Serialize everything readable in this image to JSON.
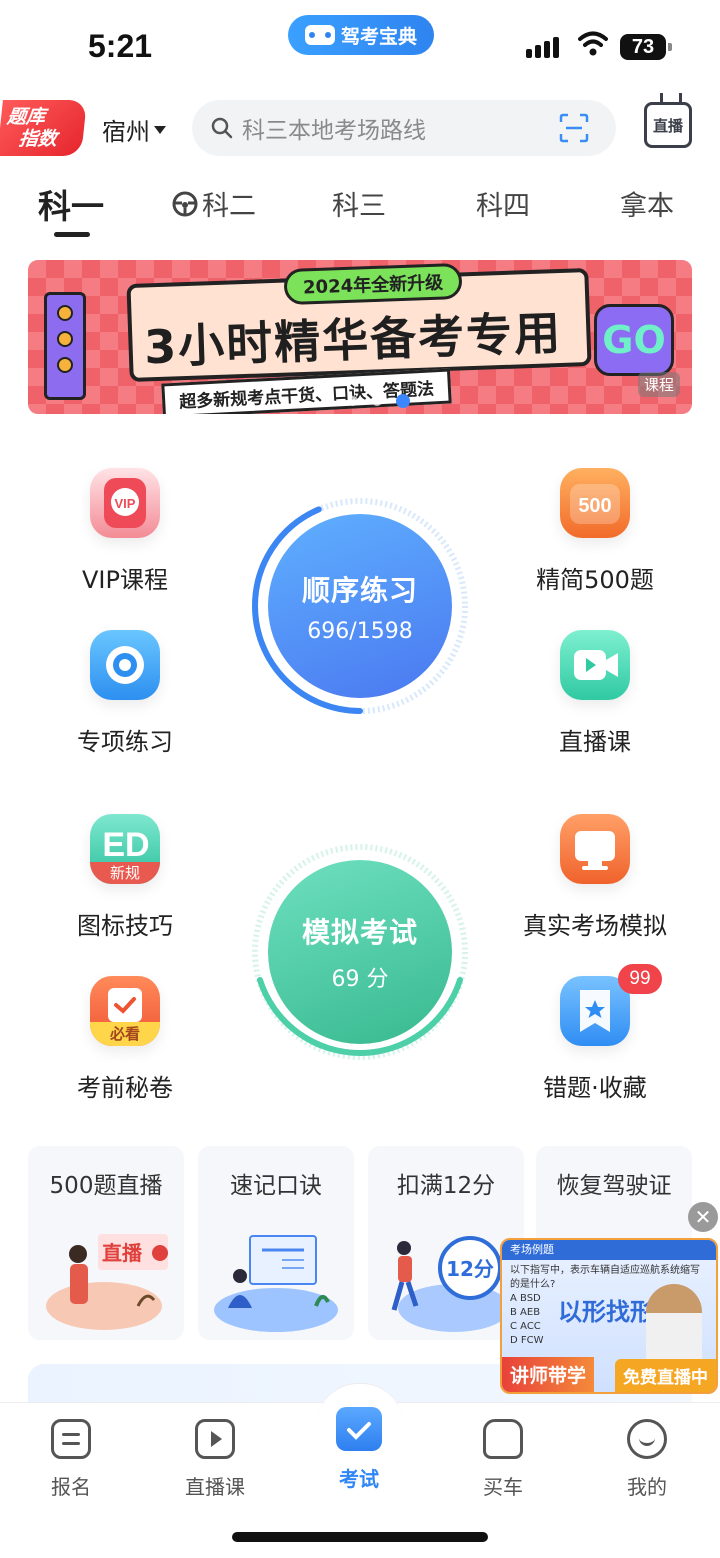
{
  "status_bar": {
    "time": "5:21",
    "app_pill": "驾考宝典",
    "battery": "73"
  },
  "header": {
    "tiku_badge_line1": "题库",
    "tiku_badge_line2": "指数",
    "city": "宿州",
    "search_placeholder": "科三本地考场路线",
    "live_label": "直播"
  },
  "tabs": [
    {
      "label": "科一"
    },
    {
      "label": "科二"
    },
    {
      "label": "科三"
    },
    {
      "label": "科四"
    },
    {
      "label": "拿本"
    }
  ],
  "banner": {
    "tag": "2024年全新升级",
    "title": "3小时精华备考专用",
    "subtitle": "超多新规考点干货、口诀、答题法",
    "go": "GO",
    "course_tag": "课程"
  },
  "features": {
    "vip": "VIP课程",
    "jingjian": "精简500题",
    "zhuanxiang": "专项练习",
    "zhibo": "直播课",
    "tubiao": "图标技巧",
    "tubiao_badge": "新规",
    "zhenshi": "真实考场模拟",
    "kaoqian": "考前秘卷",
    "kaoqian_badge": "必看",
    "cuoti": "错题·收藏",
    "cuoti_count": "99",
    "icon_500": "500",
    "icon_vip": "VIP"
  },
  "practice": {
    "title": "顺序练习",
    "progress_text": "696/1598",
    "progress_fraction": 0.4356
  },
  "exam": {
    "title": "模拟考试",
    "score_text": "69 分"
  },
  "quick_cards": [
    {
      "title": "500题直播",
      "art_text": "直播"
    },
    {
      "title": "速记口诀"
    },
    {
      "title": "扣满12分",
      "art_text": "12分"
    },
    {
      "title": "恢复驾驶证"
    }
  ],
  "float_video": {
    "header": "考场例题",
    "question": "以下指写中，表示车辆自适应巡航系统缩写的是什么?",
    "options": [
      "A  BSD",
      "B  AEB",
      "C  ACC",
      "D  FCW"
    ],
    "big_text": "以形找形",
    "left_label": "讲师带学",
    "right_label": "免费直播中"
  },
  "bottom_nav": [
    {
      "label": "报名"
    },
    {
      "label": "直播课"
    },
    {
      "label": "考试"
    },
    {
      "label": "买车"
    },
    {
      "label": "我的"
    }
  ],
  "colors": {
    "accent": "#2f86f6",
    "practice_blue": "#4a8df5",
    "exam_green": "#4dcfa8",
    "badge_red": "#f0434a"
  }
}
